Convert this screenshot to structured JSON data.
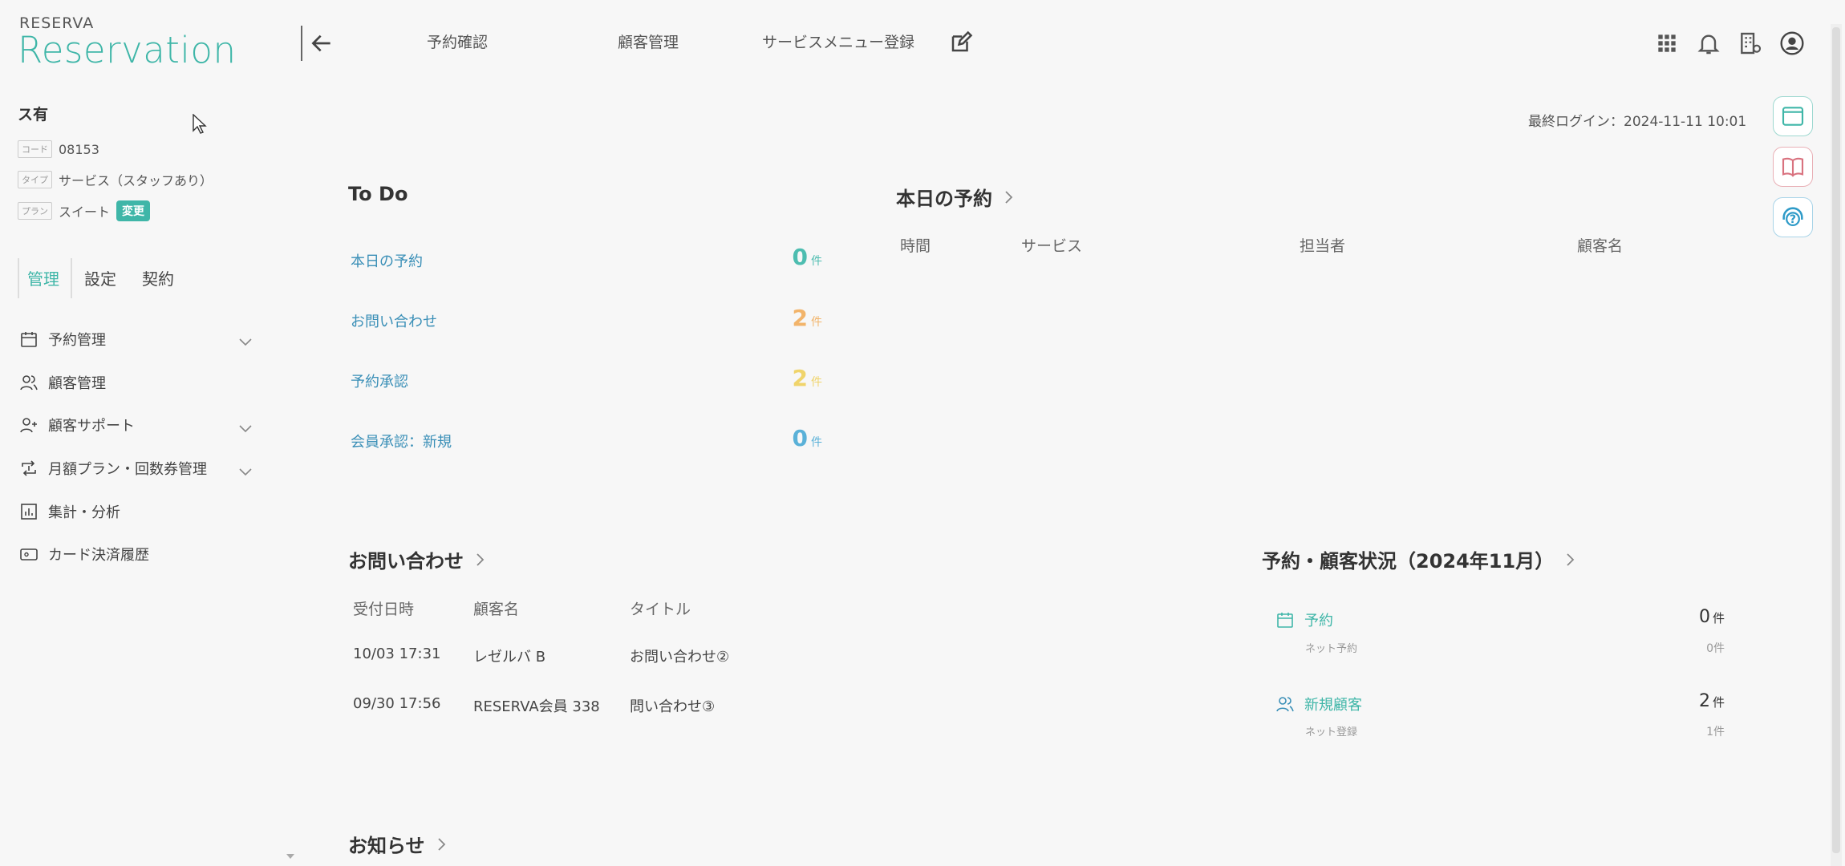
{
  "brand": {
    "small": "RESERVA",
    "main": "Reservation"
  },
  "topnav": {
    "reserve": "予約確認",
    "customers": "顧客管理",
    "service": "サービスメニュー登録"
  },
  "header_icons": [
    "back-arrow-icon",
    "edit-icon",
    "apps-grid-icon",
    "bell-icon",
    "building-settings-icon",
    "user-circle-icon"
  ],
  "store": {
    "name": "ス有",
    "code_tag": "コード",
    "code": "08153",
    "type_tag": "タイプ",
    "type": "サービス（スタッフあり）",
    "plan_tag": "プラン",
    "plan": "スイート",
    "change_label": "変更"
  },
  "sidebar_tabs": {
    "manage": "管理",
    "settings": "設定",
    "contract": "契約"
  },
  "menu": [
    {
      "label": "予約管理",
      "icon": "calendar-icon",
      "expandable": true
    },
    {
      "label": "顧客管理",
      "icon": "users-icon",
      "expandable": false
    },
    {
      "label": "顧客サポート",
      "icon": "user-add-icon",
      "expandable": true
    },
    {
      "label": "月額プラン・回数券管理",
      "icon": "repeat-icon",
      "expandable": true
    },
    {
      "label": "集計・分析",
      "icon": "chart-icon",
      "expandable": false
    },
    {
      "label": "カード決済履歴",
      "icon": "card-icon",
      "expandable": false
    }
  ],
  "last_login": "最終ログイン：2024-11-11 10:01",
  "todo": {
    "title": "To Do",
    "unit": "件",
    "items": [
      {
        "label": "本日の予約",
        "count": "0",
        "color": "#4dbdb0"
      },
      {
        "label": "お問い合わせ",
        "count": "2",
        "color": "#f2b46a"
      },
      {
        "label": "予約承認",
        "count": "2",
        "color": "#f0d46b"
      },
      {
        "label": "会員承認：新規",
        "count": "0",
        "color": "#5ab1d8"
      }
    ]
  },
  "today": {
    "title": "本日の予約",
    "headers": {
      "time": "時間",
      "service": "サービス",
      "staff": "担当者",
      "customer": "顧客名"
    }
  },
  "inquiries": {
    "title": "お問い合わせ",
    "headers": {
      "date": "受付日時",
      "name": "顧客名",
      "title": "タイトル"
    },
    "rows": [
      {
        "date": "10/03 17:31",
        "name": "レゼルバ B",
        "title": "お問い合わせ②"
      },
      {
        "date": "09/30 17:56",
        "name": "RESERVA会員 338",
        "title": "問い合わせ③"
      }
    ]
  },
  "status": {
    "title": "予約・顧客状況（2024年11月）",
    "unit": "件",
    "items": [
      {
        "label": "予約",
        "sub": "ネット予約",
        "count": "0",
        "sub_count": "0"
      },
      {
        "label": "新規顧客",
        "sub": "ネット登録",
        "count": "2",
        "sub_count": "1"
      }
    ]
  },
  "news": {
    "title": "お知らせ"
  },
  "colors": {
    "accent": "#3fb6a8",
    "link": "#3a8fb7"
  }
}
